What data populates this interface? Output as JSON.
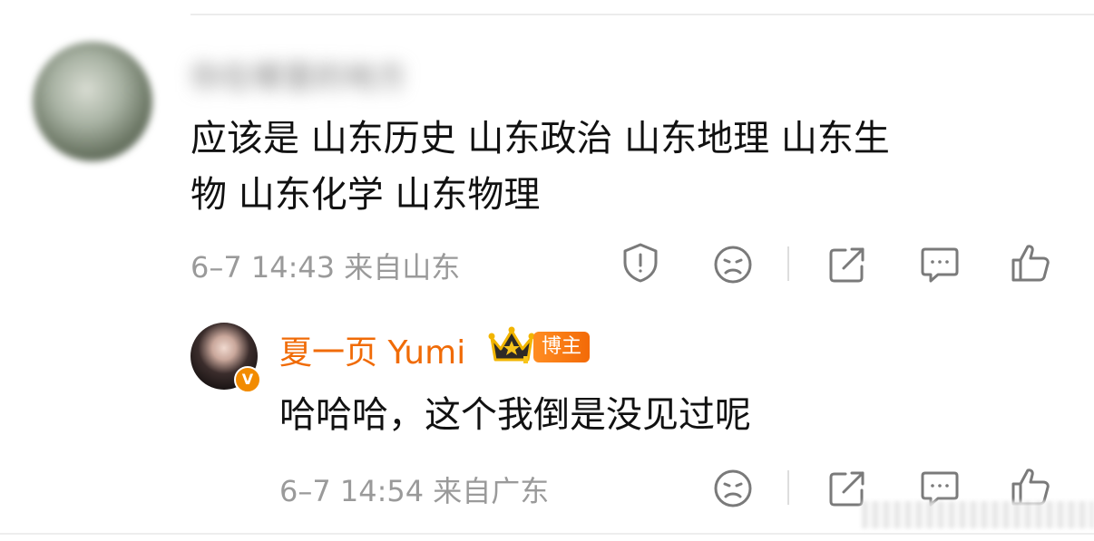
{
  "comment": {
    "username": "你在哪里的地方",
    "text": "应该是 山东历史 山东政治 山东地理 山东生\n物 山东化学 山东物理",
    "meta": "6–7 14:43  来自山东",
    "actions": [
      "report-icon",
      "dislike-icon",
      "share-icon",
      "comment-icon",
      "like-icon"
    ]
  },
  "reply": {
    "username": "夏一页 Yumi",
    "badge": "博主",
    "verified_mark": "V",
    "text": "哈哈哈，这个我倒是没见过呢",
    "meta": "6–7 14:54  来自广东",
    "actions": [
      "dislike-icon",
      "share-icon",
      "comment-icon",
      "like-icon"
    ]
  },
  "colors": {
    "accent": "#f06b07",
    "muted_text": "#9a9a9a",
    "icon_stroke": "#7a7a7a"
  }
}
